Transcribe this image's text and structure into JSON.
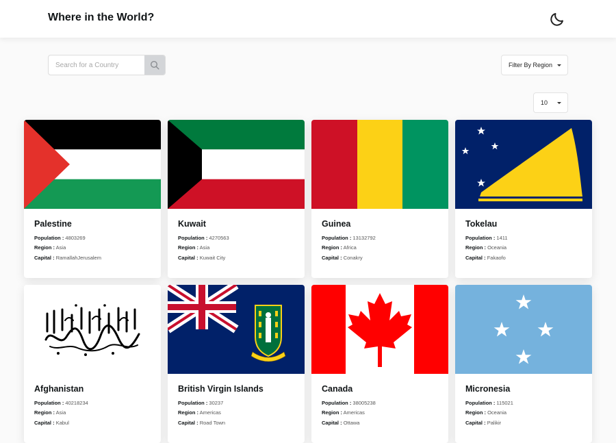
{
  "header": {
    "title": "Where in the World?",
    "theme_icon": "moon-icon"
  },
  "search": {
    "placeholder": "Search for a Country",
    "value": "",
    "icon": "search-icon"
  },
  "filter": {
    "label": "Filter By Region",
    "icon": "caret-down-icon"
  },
  "per_page": {
    "value": "10",
    "icon": "caret-down-icon"
  },
  "labels": {
    "population": "Population :",
    "region": "Region :",
    "capital": "Capital :"
  },
  "countries": [
    {
      "name": "Palestine",
      "population": "4803269",
      "region": "Asia",
      "capital": "RamallahJerusalem"
    },
    {
      "name": "Kuwait",
      "population": "4270563",
      "region": "Asia",
      "capital": "Kuwait City"
    },
    {
      "name": "Guinea",
      "population": "13132792",
      "region": "Africa",
      "capital": "Conakry"
    },
    {
      "name": "Tokelau",
      "population": "1411",
      "region": "Oceania",
      "capital": "Fakaofo"
    },
    {
      "name": "Afghanistan",
      "population": "40218234",
      "region": "Asia",
      "capital": "Kabul"
    },
    {
      "name": "British Virgin Islands",
      "population": "30237",
      "region": "Americas",
      "capital": "Road Town"
    },
    {
      "name": "Canada",
      "population": "38005238",
      "region": "Americas",
      "capital": "Ottawa"
    },
    {
      "name": "Micronesia",
      "population": "115021",
      "region": "Oceania",
      "capital": "Palikir"
    }
  ],
  "colors": {
    "background": "#fafafa",
    "card": "#ffffff",
    "text": "#111517",
    "search_button": "#d3d5d8"
  }
}
